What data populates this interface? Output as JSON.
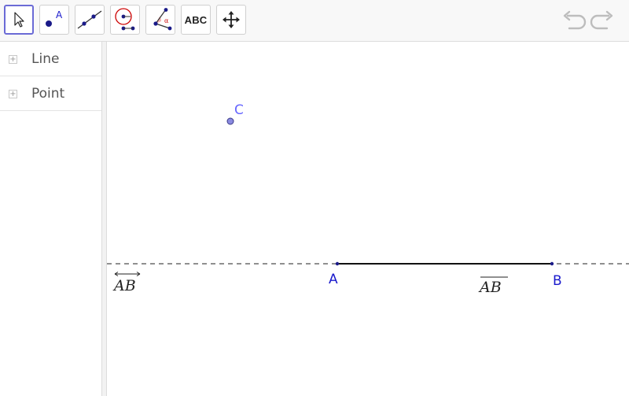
{
  "toolbar": {
    "tools": [
      {
        "name": "move-tool",
        "icon": "arrow-cursor-icon",
        "selected": true
      },
      {
        "name": "point-tool",
        "icon": "point-icon",
        "glyph": "A"
      },
      {
        "name": "line-tool",
        "icon": "line-icon"
      },
      {
        "name": "circle-tool",
        "icon": "circle-icon"
      },
      {
        "name": "angle-tool",
        "icon": "angle-icon",
        "glyph": "α"
      },
      {
        "name": "text-tool",
        "icon": "text-icon",
        "label": "ABC"
      },
      {
        "name": "move-graphics-tool",
        "icon": "move-arrows-icon"
      }
    ],
    "undo_icon": "undo-icon",
    "redo_icon": "redo-icon"
  },
  "algebra": {
    "groups": [
      {
        "label": "Line",
        "toggle": "+"
      },
      {
        "label": "Point",
        "toggle": "+"
      }
    ]
  },
  "graphics": {
    "points": [
      {
        "label": "C",
        "color": "#6666ff"
      },
      {
        "label": "A",
        "color": "#1a1acc"
      },
      {
        "label": "B",
        "color": "#1a1acc"
      }
    ],
    "line_label": "AB",
    "segment_label": "AB"
  },
  "colors": {
    "accent": "#6b6bd6",
    "point_blue": "#1a1acc",
    "point_c": "#6666ff",
    "circle_red": "#cc0000"
  }
}
